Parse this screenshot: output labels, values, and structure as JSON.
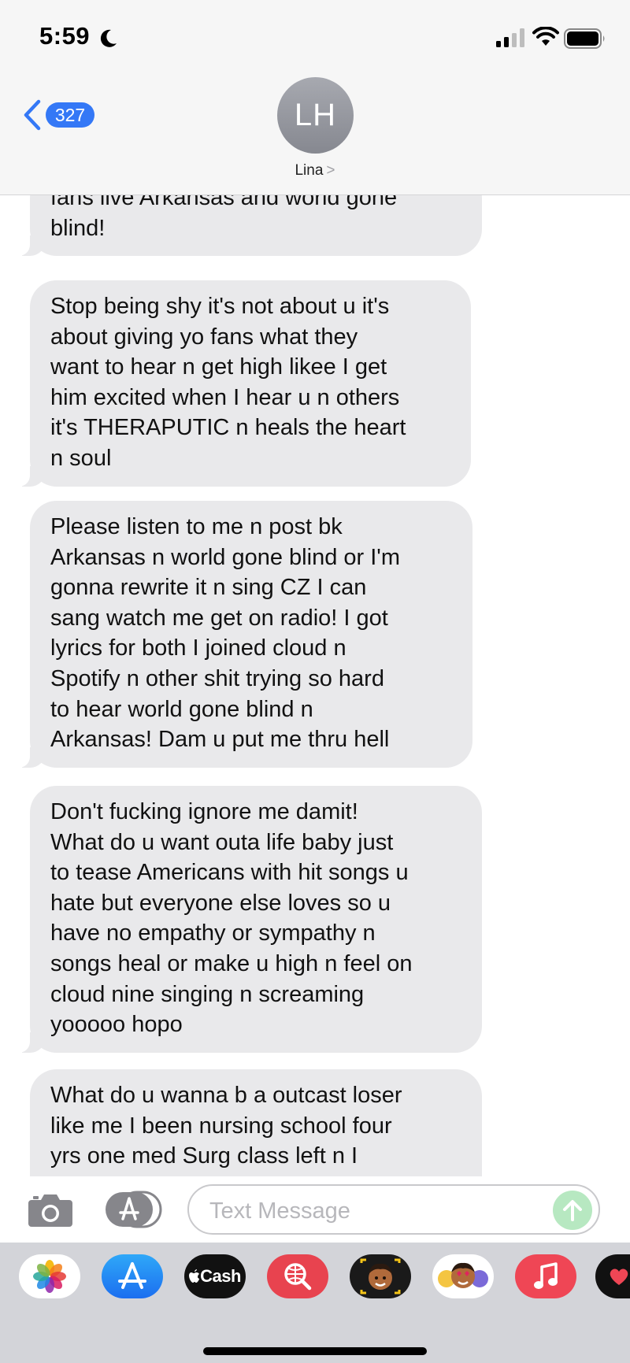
{
  "status_bar": {
    "time": "5:59"
  },
  "header": {
    "back_count": "327",
    "avatar_initials": "LH",
    "contact_name": "Lina",
    "contact_chevron": ">"
  },
  "messages": [
    {
      "text": "fans live Arkansas and world gone\nblind!"
    },
    {
      "text": "Stop being shy it's not about u it's\nabout giving yo fans what they\nwant to hear n get high likee I get\nhim excited when I hear u n others\nit's THERAPUTIC n heals the heart\nn soul"
    },
    {
      "text": "Please listen to me n post bk\nArkansas n world gone blind or I'm\ngonna rewrite it n sing CZ I can\nsang watch me get on radio! I got\nlyrics for both I joined cloud n\nSpotify n other shit trying so hard\nto hear world gone blind n\nArkansas! Dam u put me thru hell"
    },
    {
      "text": "Don't fucking ignore me damit!\nWhat do u want outa life baby just\nto tease Americans with hit songs u\nhate but everyone else loves so u\nhave no empathy or sympathy n\nsongs heal or make u high n feel on\ncloud nine singing n screaming\nyooooo hopo"
    },
    {
      "text": "What do u wanna b a outcast loser\nlike me I been nursing school four\nyrs one med Surg class left n I"
    }
  ],
  "input": {
    "placeholder": "Text Message"
  },
  "app_drawer": {
    "apps": [
      "photos-icon",
      "app-store-icon",
      "cash-icon",
      "web-search-icon",
      "memoji-icon",
      "memoji-stickers-icon",
      "music-icon",
      "digital-touch-icon"
    ],
    "cash_label": "Cash"
  },
  "colors": {
    "bubble_gray": "#e9e9eb",
    "accent_blue": "#3478f6",
    "send_green": "#b7e8c1"
  }
}
